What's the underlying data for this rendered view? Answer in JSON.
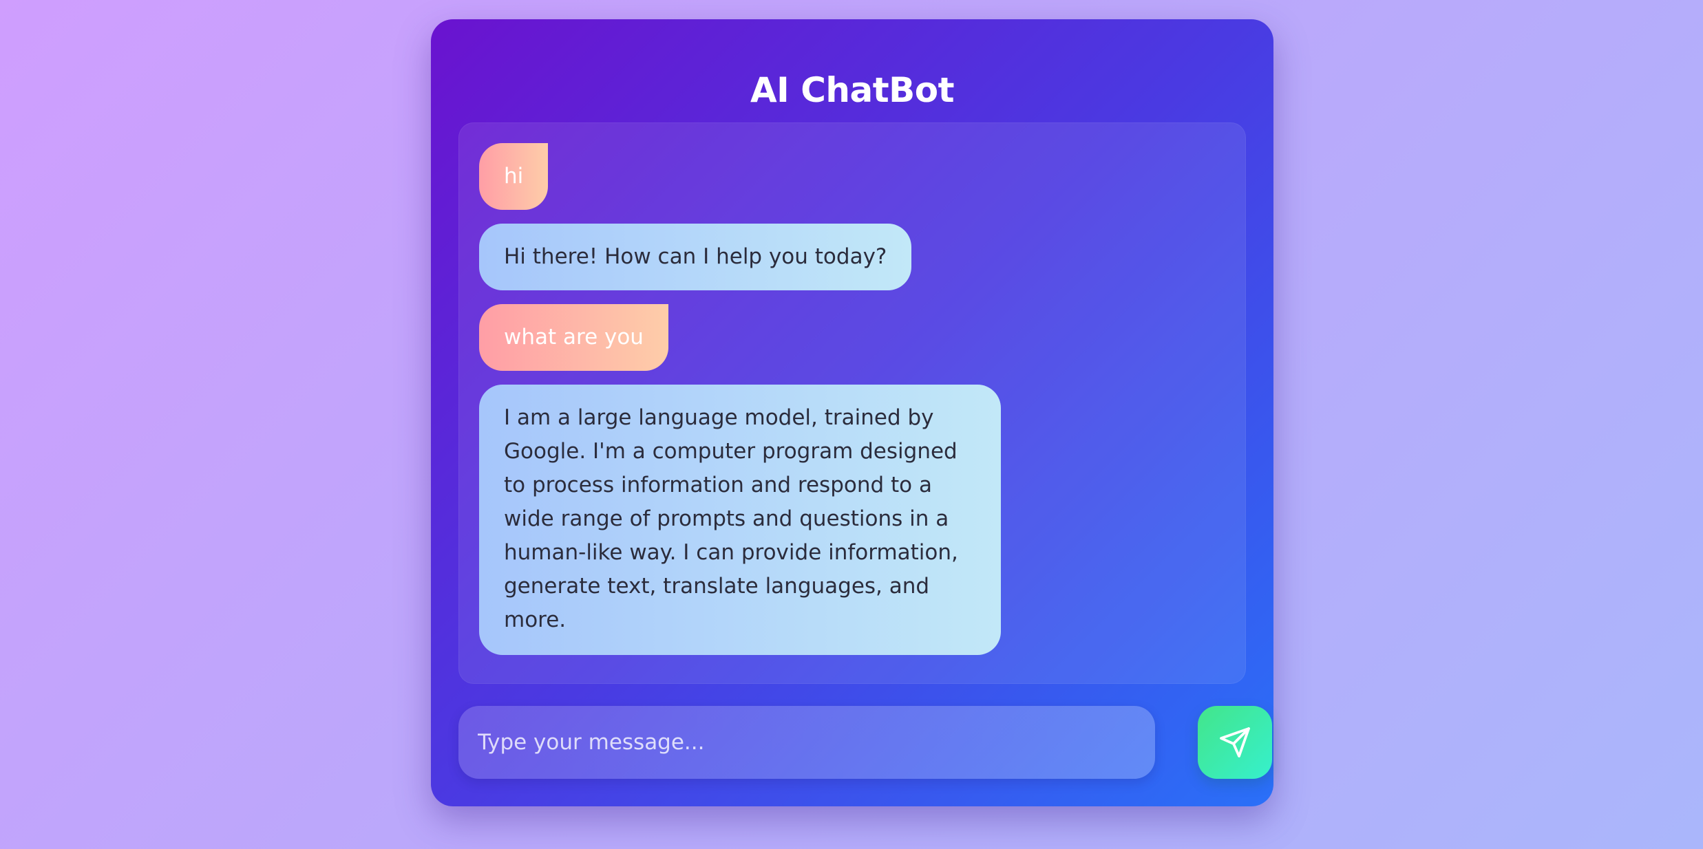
{
  "app": {
    "title": "AI ChatBot"
  },
  "messages": [
    {
      "role": "user",
      "text": "hi"
    },
    {
      "role": "bot",
      "text": "Hi there! How can I help you today?"
    },
    {
      "role": "user",
      "text": "what are you"
    },
    {
      "role": "bot",
      "text": "I am a large language model, trained by Google. I'm a computer program designed to process information and respond to a wide range of prompts and questions in a human-like way. I can provide information, generate text, translate languages, and more."
    }
  ],
  "composer": {
    "placeholder": "Type your message...",
    "value": "",
    "send_icon": "send-icon"
  },
  "colors": {
    "card_gradient_start": "#6a13cf",
    "card_gradient_end": "#2a70f8",
    "user_bubble_start": "#ff9ea6",
    "user_bubble_end": "#fecda9",
    "bot_bubble_start": "#a6c6fb",
    "bot_bubble_end": "#c2e8f8",
    "send_button_start": "#43e58a",
    "send_button_end": "#36f0cd"
  }
}
